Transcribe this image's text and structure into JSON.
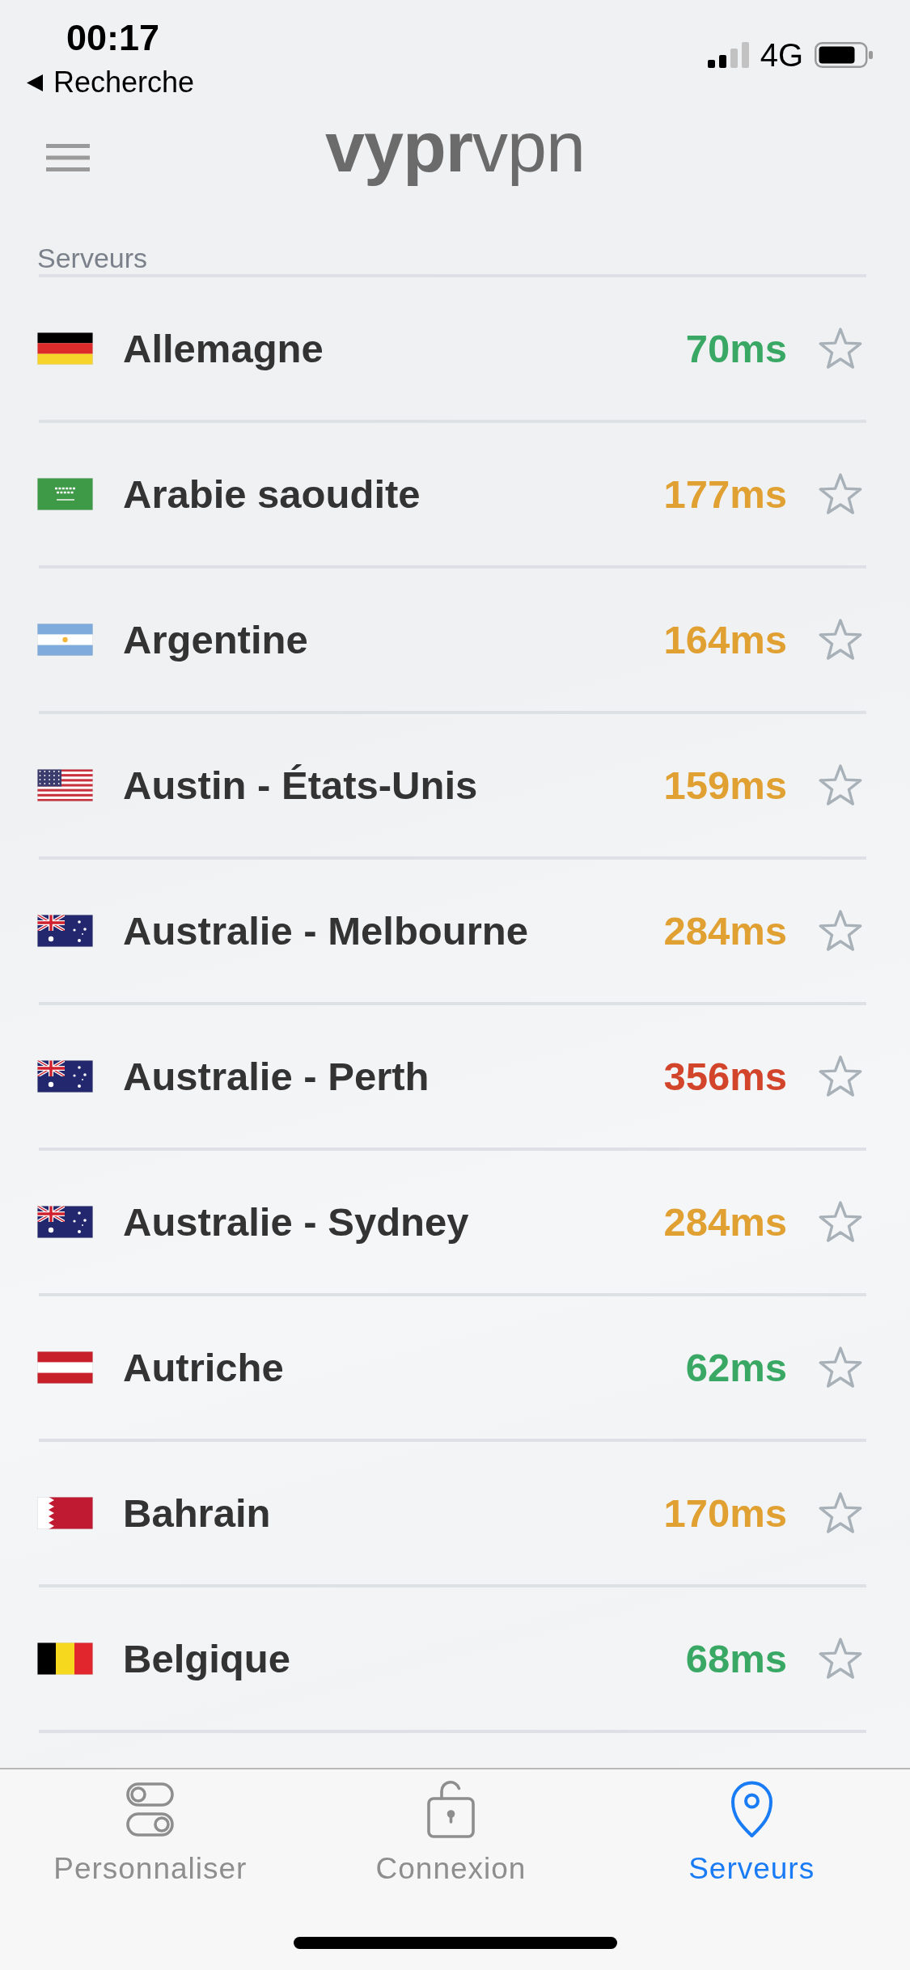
{
  "status_bar": {
    "time": "00:17",
    "back_label": "Recherche",
    "network": "4G"
  },
  "header": {
    "logo": "**vypr**vpn"
  },
  "section_title": "Serveurs",
  "servers": [
    {
      "kind": "germany",
      "name": "Allemagne",
      "ping": "70ms",
      "color": "#3aa865",
      "favorite": false
    },
    {
      "kind": "saudi",
      "name": "Arabie saoudite",
      "ping": "177ms",
      "color": "#e0a032",
      "favorite": false
    },
    {
      "kind": "argentina",
      "name": "Argentine",
      "ping": "164ms",
      "color": "#e0a032",
      "favorite": false
    },
    {
      "kind": "usa",
      "name": "Austin - États-Unis",
      "ping": "159ms",
      "color": "#e0a032",
      "favorite": false
    },
    {
      "kind": "australia",
      "name": "Australie - Melbourne",
      "ping": "284ms",
      "color": "#e0a032",
      "favorite": false
    },
    {
      "kind": "australia",
      "name": "Australie - Perth",
      "ping": "356ms",
      "color": "#d2452b",
      "favorite": false
    },
    {
      "kind": "australia",
      "name": "Australie - Sydney",
      "ping": "284ms",
      "color": "#e0a032",
      "favorite": false
    },
    {
      "kind": "austria",
      "name": "Autriche",
      "ping": "62ms",
      "color": "#3aa865",
      "favorite": false
    },
    {
      "kind": "bahrain",
      "name": "Bahrain",
      "ping": "170ms",
      "color": "#e0a032",
      "favorite": false
    },
    {
      "kind": "belgium",
      "name": "Belgique",
      "ping": "68ms",
      "color": "#3aa865",
      "favorite": false
    }
  ],
  "tab_bar": {
    "tabs": [
      {
        "kind": "toggles",
        "label": "Personnaliser",
        "selected": false
      },
      {
        "kind": "padlock",
        "label": "Connexion",
        "selected": false
      },
      {
        "kind": "pin",
        "label": "Serveurs",
        "selected": true
      }
    ]
  }
}
